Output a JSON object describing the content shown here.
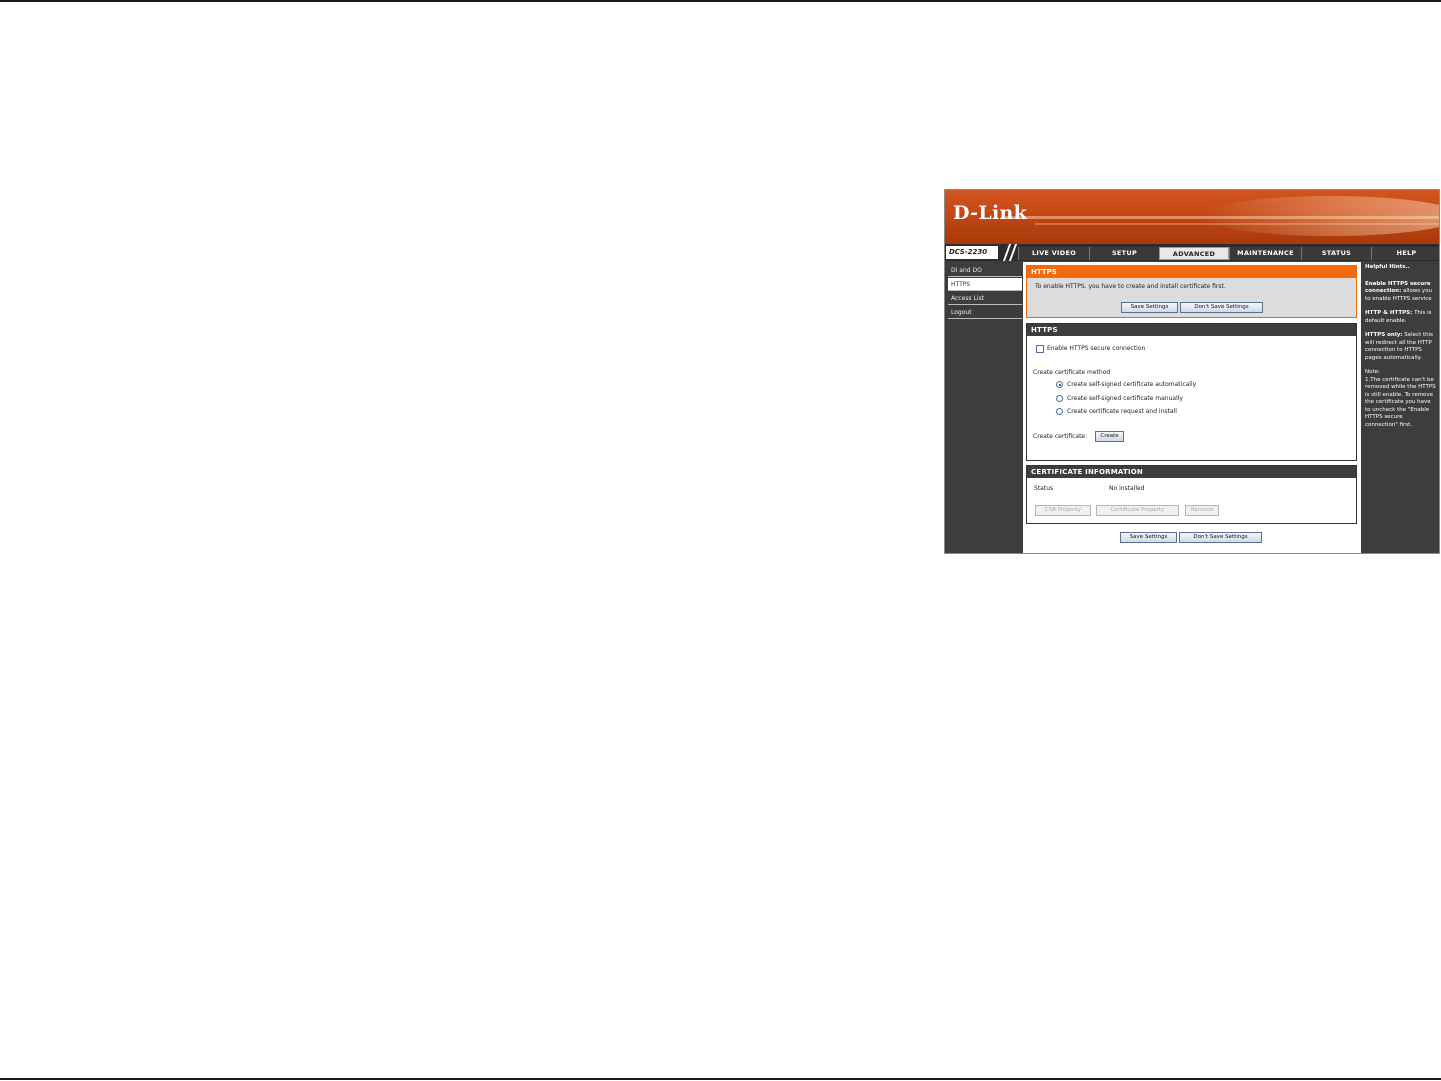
{
  "banner": {
    "logo": "D-Link"
  },
  "nav": {
    "model": "DCS-2230",
    "tabs": [
      {
        "label": "LIVE VIDEO"
      },
      {
        "label": "SETUP"
      },
      {
        "label": "ADVANCED"
      },
      {
        "label": "MAINTENANCE"
      },
      {
        "label": "STATUS"
      },
      {
        "label": "HELP"
      }
    ],
    "active_tab": "ADVANCED"
  },
  "sidebar": {
    "items": [
      {
        "label": "DI and DO"
      },
      {
        "label": "HTTPS"
      },
      {
        "label": "Access List"
      },
      {
        "label": "Logout"
      }
    ],
    "active": "HTTPS"
  },
  "intro": {
    "title": "HTTPS",
    "message": "To enable HTTPS, you have to create and install certificate first.",
    "save_label": "Save Settings",
    "dont_save_label": "Don't Save Settings"
  },
  "https_section": {
    "title": "HTTPS",
    "enable_label": "Enable HTTPS secure connection",
    "enable_checked": false,
    "method_label": "Create certificate method",
    "methods": [
      {
        "label": "Create self-signed certificate automatically",
        "selected": true
      },
      {
        "label": "Create self-signed certificate manually",
        "selected": false
      },
      {
        "label": "Create certificate request and install",
        "selected": false
      }
    ],
    "create_label": "Create certificate:",
    "create_button": "Create"
  },
  "cert_section": {
    "title": "CERTIFICATE INFORMATION",
    "status_label": "Status",
    "status_value": "No installed",
    "csr_button": "CSR Property",
    "cert_button": "Certificate Property",
    "remove_button": "Remove"
  },
  "footer": {
    "save_label": "Save Settings",
    "dont_save_label": "Don't Save Settings"
  },
  "help": {
    "title": "Helpful Hints..",
    "hints": [
      {
        "term": "Enable HTTPS secure connection:",
        "text": " allows you to enable HTTPS service"
      },
      {
        "term": "HTTP & HTTPS:",
        "text": " This is default enable."
      },
      {
        "term": "HTTPS only:",
        "text": " Select this will redirect all the HTTP connection to HTTPS pages automatically."
      }
    ],
    "note_title": "Note:",
    "note_text": "1.The certificate can't be removed while the HTTPS is still enable. To remove the certificate you have to uncheck the \"Enable HTTPS secure connection\" first."
  }
}
